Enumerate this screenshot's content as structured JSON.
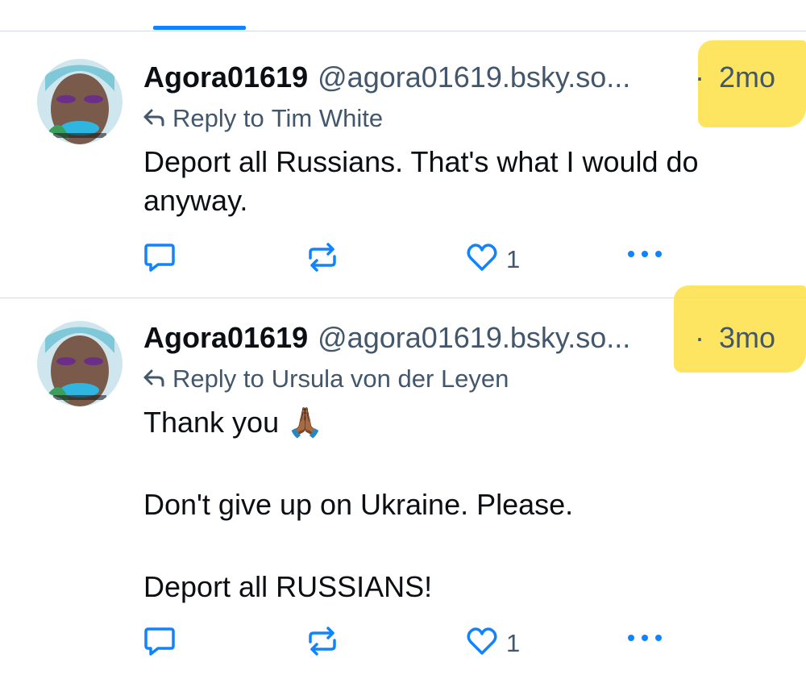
{
  "posts": [
    {
      "author_name": "Agora01619",
      "handle": "@agora01619.bsky.so...",
      "separator": "·",
      "time": "2mo",
      "reply_prefix": "Reply to",
      "reply_to": "Tim White",
      "lines": [
        "Deport all Russians. That's what I would do anyway."
      ],
      "like_count": "1"
    },
    {
      "author_name": "Agora01619",
      "handle": "@agora01619.bsky.so...",
      "separator": "·",
      "time": "3mo",
      "reply_prefix": "Reply to",
      "reply_to": "Ursula von der Leyen",
      "lines": [
        "Thank you 🙏🏾",
        "Don't give up on Ukraine. Please.",
        "Deport all RUSSIANS!"
      ],
      "like_count": "1"
    }
  ],
  "icons": {
    "reply_arrow": "reply-arrow-icon",
    "comment": "comment-bubble-icon",
    "repost": "repost-icon",
    "like": "heart-icon",
    "more": "more-dots-icon"
  },
  "colors": {
    "accent": "#1083fe",
    "muted": "#42576c",
    "highlight": "#fde047",
    "separator": "#d4dbe2"
  }
}
